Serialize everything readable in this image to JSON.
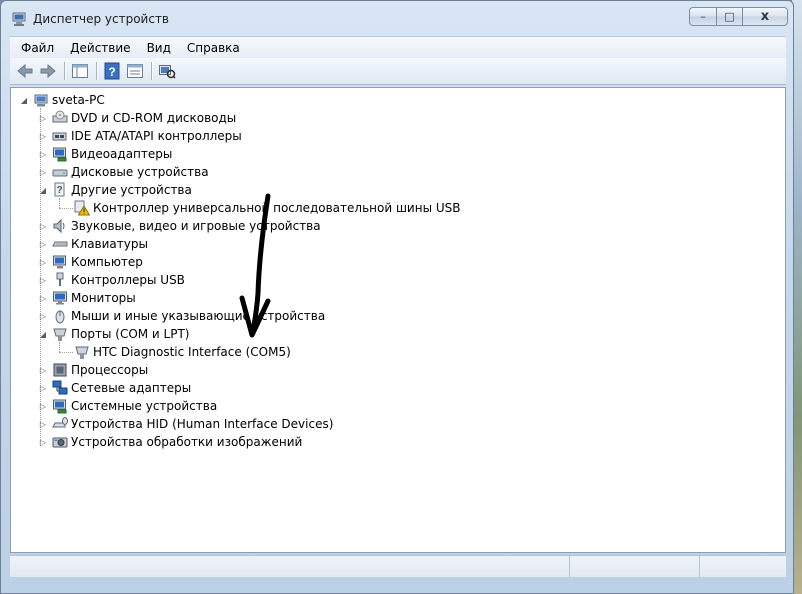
{
  "window": {
    "title": "Диспетчер устройств"
  },
  "caption_buttons": {
    "minimize": "–",
    "maximize": "□",
    "close": "x"
  },
  "menu": [
    "Файл",
    "Действие",
    "Вид",
    "Справка"
  ],
  "toolbar": {
    "buttons": [
      "back-icon",
      "forward-icon",
      "show-hide-console-tree-icon",
      "help-icon",
      "properties-icon",
      "scan-hardware-icon"
    ]
  },
  "tree": {
    "root": {
      "label": "sveta-PC",
      "expanded": true
    },
    "items": [
      {
        "label": "DVD и CD-ROM дисководы",
        "icon": "dvd-drive-icon",
        "expanded": false,
        "level": 1
      },
      {
        "label": "IDE ATA/ATAPI контроллеры",
        "icon": "ide-controller-icon",
        "expanded": false,
        "level": 1
      },
      {
        "label": "Видеоадаптеры",
        "icon": "display-adapter-icon",
        "expanded": false,
        "level": 1
      },
      {
        "label": "Дисковые устройства",
        "icon": "disk-drive-icon",
        "expanded": false,
        "level": 1
      },
      {
        "label": "Другие устройства",
        "icon": "other-devices-icon",
        "expanded": true,
        "level": 1
      },
      {
        "label": "Контроллер универсальной последовательной шины USB",
        "icon": "warning-device-icon",
        "level": 2
      },
      {
        "label": "Звуковые, видео и игровые устройства",
        "icon": "sound-icon",
        "expanded": false,
        "level": 1
      },
      {
        "label": "Клавиатуры",
        "icon": "keyboard-icon",
        "expanded": false,
        "level": 1
      },
      {
        "label": "Компьютер",
        "icon": "computer-icon",
        "expanded": false,
        "level": 1
      },
      {
        "label": "Контроллеры USB",
        "icon": "usb-icon",
        "expanded": false,
        "level": 1
      },
      {
        "label": "Мониторы",
        "icon": "monitor-icon",
        "expanded": false,
        "level": 1
      },
      {
        "label": "Мыши и иные указывающие устройства",
        "icon": "mouse-icon",
        "expanded": false,
        "level": 1
      },
      {
        "label": "Порты (COM и LPT)",
        "icon": "port-icon",
        "expanded": true,
        "level": 1
      },
      {
        "label": "HTC Diagnostic Interface (COM5)",
        "icon": "port-device-icon",
        "level": 2
      },
      {
        "label": "Процессоры",
        "icon": "processor-icon",
        "expanded": false,
        "level": 1
      },
      {
        "label": "Сетевые адаптеры",
        "icon": "network-adapter-icon",
        "expanded": false,
        "level": 1
      },
      {
        "label": "Системные устройства",
        "icon": "system-devices-icon",
        "expanded": false,
        "level": 1
      },
      {
        "label": "Устройства HID (Human Interface Devices)",
        "icon": "hid-icon",
        "expanded": false,
        "level": 1
      },
      {
        "label": "Устройства обработки изображений",
        "icon": "imaging-icon",
        "expanded": false,
        "level": 1
      }
    ]
  },
  "colors": {
    "accent": "#3a7bd5",
    "warning": "#f5c400"
  }
}
